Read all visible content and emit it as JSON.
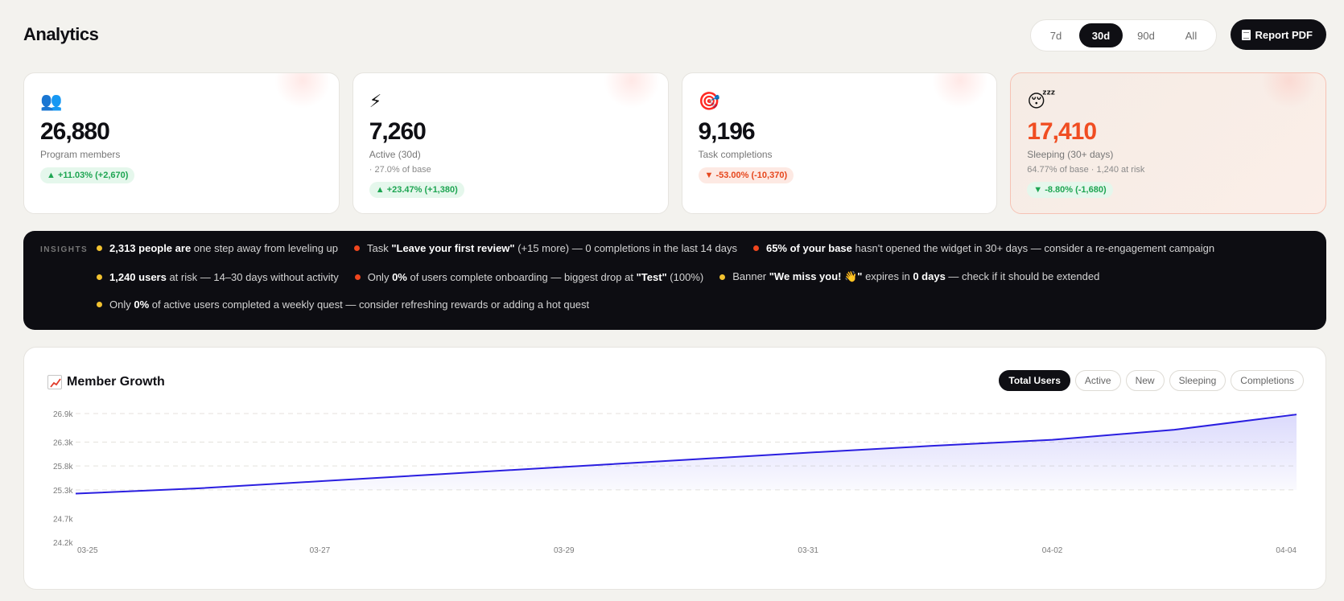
{
  "header": {
    "title": "Analytics",
    "report_label": "Report PDF"
  },
  "range": {
    "options": [
      "7d",
      "30d",
      "90d",
      "All"
    ],
    "selected": "30d"
  },
  "cards": [
    {
      "icon": "busts-in-silhouette-icon",
      "glyph": "👥",
      "value": "26,880",
      "label": "Program members",
      "sub": "",
      "delta": "▲ +11.03% (+2,670)",
      "trend": "up"
    },
    {
      "icon": "lightning-icon",
      "glyph": "⚡",
      "value": "7,260",
      "label": "Active (30d)",
      "sub": "· 27.0% of base",
      "delta": "▲ +23.47% (+1,380)",
      "trend": "up"
    },
    {
      "icon": "target-icon",
      "glyph": "🎯",
      "value": "9,196",
      "label": "Task completions",
      "sub": "",
      "delta": "▼ -53.00% (-10,370)",
      "trend": "down"
    },
    {
      "icon": "sleeping-face-icon",
      "glyph": "😴",
      "value": "17,410",
      "label": "Sleeping (30+ days)",
      "sub": "64.77% of base · 1,240 at risk",
      "delta": "▼ -8.80% (-1,680)",
      "trend": "up"
    }
  ],
  "insights": {
    "title": "INSIGHTS",
    "rows": [
      [
        {
          "dot": "yellow",
          "parts": [
            [
              "b",
              "2,313 people are"
            ],
            [
              "t",
              " one step away from leveling up"
            ]
          ]
        },
        {
          "dot": "red",
          "parts": [
            [
              "t",
              "Task "
            ],
            [
              "b",
              "\"Leave your first review\""
            ],
            [
              "t",
              " (+15 more) — 0 completions in the last 14 days"
            ]
          ]
        },
        {
          "dot": "red",
          "parts": [
            [
              "b",
              "65% of your base"
            ],
            [
              "t",
              " hasn't opened the widget in 30+ days — consider a re-engagement campaign"
            ]
          ]
        }
      ],
      [
        {
          "dot": "yellow",
          "parts": [
            [
              "b",
              "1,240 users"
            ],
            [
              "t",
              " at risk — 14–30 days without activity"
            ]
          ]
        },
        {
          "dot": "red",
          "parts": [
            [
              "t",
              "Only "
            ],
            [
              "b",
              "0%"
            ],
            [
              "t",
              " of users complete onboarding — biggest drop at "
            ],
            [
              "b",
              "\"Test\""
            ],
            [
              "t",
              " (100%)"
            ]
          ]
        },
        {
          "dot": "yellow",
          "parts": [
            [
              "t",
              "Banner "
            ],
            [
              "b",
              "\"We miss you! 👋\""
            ],
            [
              "t",
              " expires in "
            ],
            [
              "b",
              "0 days"
            ],
            [
              "t",
              " — check if it should be extended"
            ]
          ]
        }
      ],
      [
        {
          "dot": "yellow",
          "parts": [
            [
              "t",
              "Only "
            ],
            [
              "b",
              "0%"
            ],
            [
              "t",
              " of active users completed a weekly quest — consider refreshing rewards or adding a hot quest"
            ]
          ]
        }
      ]
    ]
  },
  "growth": {
    "title": "Member Growth",
    "tabs": [
      "Total Users",
      "Active",
      "New",
      "Sleeping",
      "Completions"
    ],
    "selected_tab": "Total Users"
  },
  "chart_data": {
    "type": "area",
    "title": "Member Growth",
    "series": [
      {
        "name": "Total Users",
        "x": [
          "03-25",
          "03-26",
          "03-27",
          "03-28",
          "03-29",
          "03-30",
          "03-31",
          "04-01",
          "04-02",
          "04-03",
          "04-04"
        ],
        "values": [
          25220,
          25330,
          25480,
          25630,
          25780,
          25930,
          26080,
          26220,
          26350,
          26560,
          26880
        ]
      }
    ],
    "x_tick_labels": [
      "03-25",
      "03-27",
      "03-29",
      "03-31",
      "04-02",
      "04-04"
    ],
    "y_tick_labels": [
      "26.9k",
      "26.3k",
      "25.8k",
      "25.3k",
      "24.7k",
      "24.2k"
    ],
    "y_tick_values": [
      26900,
      26300,
      25800,
      25300,
      24700,
      24200
    ],
    "ylim": [
      24200,
      26900
    ],
    "grid": true,
    "line_color": "#2a1ee0",
    "fill_color": "#5b55f0"
  },
  "colors": {
    "accent": "#0f0f14",
    "positive": "#1ea552",
    "negative": "#f04d22",
    "warn_yellow": "#f2c230"
  }
}
